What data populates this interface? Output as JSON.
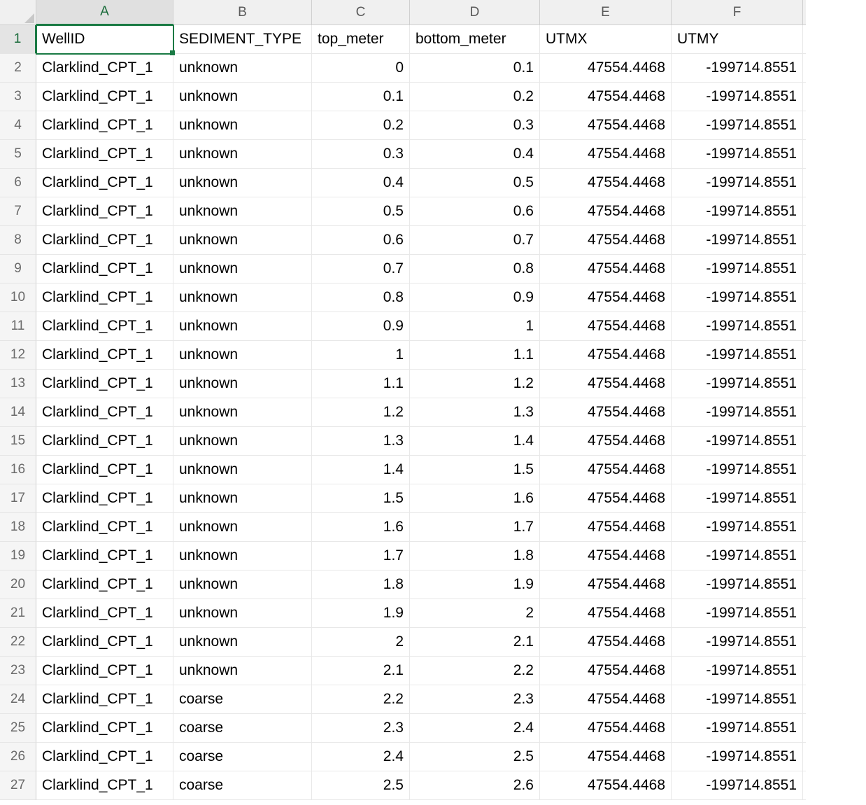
{
  "columns": [
    "A",
    "B",
    "C",
    "D",
    "E",
    "F"
  ],
  "selected_cell": "A1",
  "headers": {
    "A": "WellID",
    "B": "SEDIMENT_TYPE",
    "C": "top_meter",
    "D": "bottom_meter",
    "E": "UTMX",
    "F": "UTMY"
  },
  "rows": [
    {
      "n": 2,
      "A": "Clarklind_CPT_1",
      "B": "unknown",
      "C": "0",
      "D": "0.1",
      "E": "47554.4468",
      "F": "-199714.8551"
    },
    {
      "n": 3,
      "A": "Clarklind_CPT_1",
      "B": "unknown",
      "C": "0.1",
      "D": "0.2",
      "E": "47554.4468",
      "F": "-199714.8551"
    },
    {
      "n": 4,
      "A": "Clarklind_CPT_1",
      "B": "unknown",
      "C": "0.2",
      "D": "0.3",
      "E": "47554.4468",
      "F": "-199714.8551"
    },
    {
      "n": 5,
      "A": "Clarklind_CPT_1",
      "B": "unknown",
      "C": "0.3",
      "D": "0.4",
      "E": "47554.4468",
      "F": "-199714.8551"
    },
    {
      "n": 6,
      "A": "Clarklind_CPT_1",
      "B": "unknown",
      "C": "0.4",
      "D": "0.5",
      "E": "47554.4468",
      "F": "-199714.8551"
    },
    {
      "n": 7,
      "A": "Clarklind_CPT_1",
      "B": "unknown",
      "C": "0.5",
      "D": "0.6",
      "E": "47554.4468",
      "F": "-199714.8551"
    },
    {
      "n": 8,
      "A": "Clarklind_CPT_1",
      "B": "unknown",
      "C": "0.6",
      "D": "0.7",
      "E": "47554.4468",
      "F": "-199714.8551"
    },
    {
      "n": 9,
      "A": "Clarklind_CPT_1",
      "B": "unknown",
      "C": "0.7",
      "D": "0.8",
      "E": "47554.4468",
      "F": "-199714.8551"
    },
    {
      "n": 10,
      "A": "Clarklind_CPT_1",
      "B": "unknown",
      "C": "0.8",
      "D": "0.9",
      "E": "47554.4468",
      "F": "-199714.8551"
    },
    {
      "n": 11,
      "A": "Clarklind_CPT_1",
      "B": "unknown",
      "C": "0.9",
      "D": "1",
      "E": "47554.4468",
      "F": "-199714.8551"
    },
    {
      "n": 12,
      "A": "Clarklind_CPT_1",
      "B": "unknown",
      "C": "1",
      "D": "1.1",
      "E": "47554.4468",
      "F": "-199714.8551"
    },
    {
      "n": 13,
      "A": "Clarklind_CPT_1",
      "B": "unknown",
      "C": "1.1",
      "D": "1.2",
      "E": "47554.4468",
      "F": "-199714.8551"
    },
    {
      "n": 14,
      "A": "Clarklind_CPT_1",
      "B": "unknown",
      "C": "1.2",
      "D": "1.3",
      "E": "47554.4468",
      "F": "-199714.8551"
    },
    {
      "n": 15,
      "A": "Clarklind_CPT_1",
      "B": "unknown",
      "C": "1.3",
      "D": "1.4",
      "E": "47554.4468",
      "F": "-199714.8551"
    },
    {
      "n": 16,
      "A": "Clarklind_CPT_1",
      "B": "unknown",
      "C": "1.4",
      "D": "1.5",
      "E": "47554.4468",
      "F": "-199714.8551"
    },
    {
      "n": 17,
      "A": "Clarklind_CPT_1",
      "B": "unknown",
      "C": "1.5",
      "D": "1.6",
      "E": "47554.4468",
      "F": "-199714.8551"
    },
    {
      "n": 18,
      "A": "Clarklind_CPT_1",
      "B": "unknown",
      "C": "1.6",
      "D": "1.7",
      "E": "47554.4468",
      "F": "-199714.8551"
    },
    {
      "n": 19,
      "A": "Clarklind_CPT_1",
      "B": "unknown",
      "C": "1.7",
      "D": "1.8",
      "E": "47554.4468",
      "F": "-199714.8551"
    },
    {
      "n": 20,
      "A": "Clarklind_CPT_1",
      "B": "unknown",
      "C": "1.8",
      "D": "1.9",
      "E": "47554.4468",
      "F": "-199714.8551"
    },
    {
      "n": 21,
      "A": "Clarklind_CPT_1",
      "B": "unknown",
      "C": "1.9",
      "D": "2",
      "E": "47554.4468",
      "F": "-199714.8551"
    },
    {
      "n": 22,
      "A": "Clarklind_CPT_1",
      "B": "unknown",
      "C": "2",
      "D": "2.1",
      "E": "47554.4468",
      "F": "-199714.8551"
    },
    {
      "n": 23,
      "A": "Clarklind_CPT_1",
      "B": "unknown",
      "C": "2.1",
      "D": "2.2",
      "E": "47554.4468",
      "F": "-199714.8551"
    },
    {
      "n": 24,
      "A": "Clarklind_CPT_1",
      "B": "coarse",
      "C": "2.2",
      "D": "2.3",
      "E": "47554.4468",
      "F": "-199714.8551"
    },
    {
      "n": 25,
      "A": "Clarklind_CPT_1",
      "B": "coarse",
      "C": "2.3",
      "D": "2.4",
      "E": "47554.4468",
      "F": "-199714.8551"
    },
    {
      "n": 26,
      "A": "Clarklind_CPT_1",
      "B": "coarse",
      "C": "2.4",
      "D": "2.5",
      "E": "47554.4468",
      "F": "-199714.8551"
    },
    {
      "n": 27,
      "A": "Clarklind_CPT_1",
      "B": "coarse",
      "C": "2.5",
      "D": "2.6",
      "E": "47554.4468",
      "F": "-199714.8551"
    }
  ]
}
